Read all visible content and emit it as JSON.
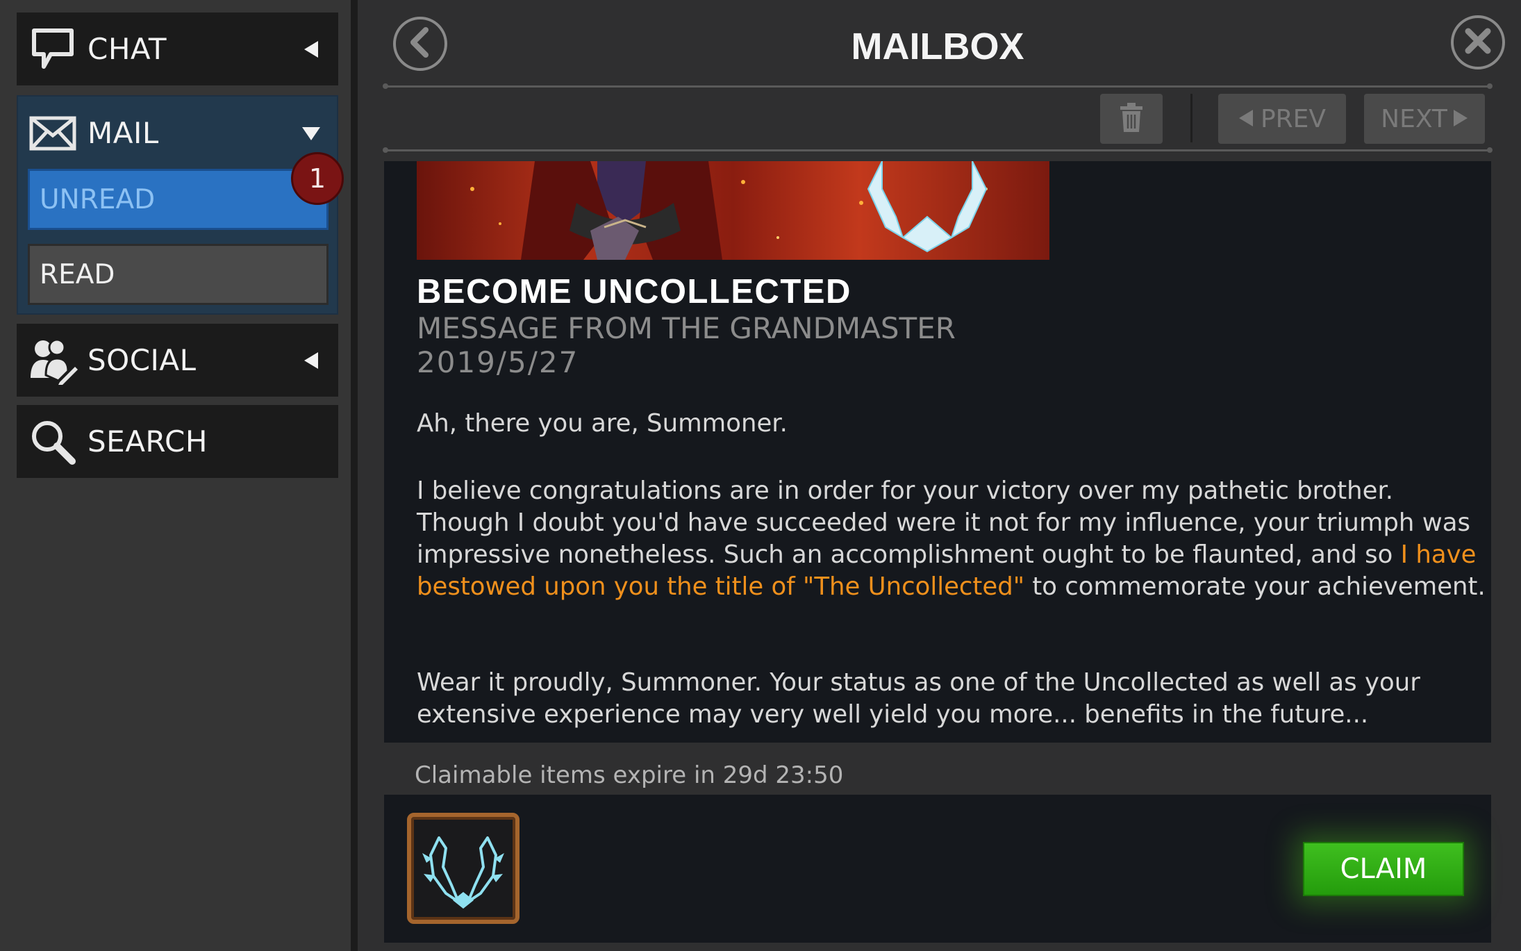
{
  "sidebar": {
    "chat_label": "CHAT",
    "mail_label": "MAIL",
    "unread_label": "UNREAD",
    "unread_count": "1",
    "read_label": "READ",
    "social_label": "SOCIAL",
    "search_label": "SEARCH"
  },
  "header": {
    "title": "MAILBOX"
  },
  "toolbar": {
    "prev_label": "PREV",
    "next_label": "NEXT"
  },
  "message": {
    "title": "BECOME UNCOLLECTED",
    "sender": "MESSAGE FROM THE GRANDMASTER",
    "date": "2019/5/27",
    "greeting": "Ah, there you are, Summoner.",
    "paragraph1_a": "I believe congratulations are in order for your victory over my pathetic brother. Though I doubt you'd have succeeded were it not for my influence, your triumph was impressive nonetheless. Such an accomplishment ought to be flaunted, and so ",
    "paragraph1_highlight": "I have bestowed upon you the title of \"The Uncollected\"",
    "paragraph1_b": " to commemorate your achievement.",
    "paragraph2": "Wear it proudly, Summoner. Your status as one of the Uncollected as well as your extensive experience may very well yield you more... benefits in the future..."
  },
  "rewards": {
    "expire_text": "Claimable items expire in 29d 23:50",
    "claim_label": "CLAIM",
    "icon": "laurel-wreath-icon"
  },
  "colors": {
    "accent_blue": "#2a72c2",
    "highlight_orange": "#f0901c",
    "claim_green": "#2fae14",
    "badge_red": "#7a1414"
  }
}
